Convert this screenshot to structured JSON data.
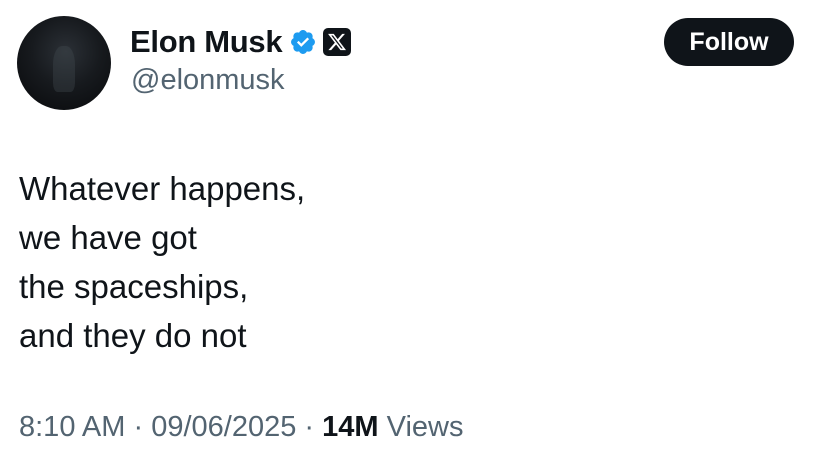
{
  "author": {
    "display_name": "Elon Musk",
    "handle": "@elonmusk",
    "avatar_icon": "avatar",
    "verified_icon": "verified-badge-icon",
    "verified_color": "#1d9bf0",
    "affiliation_icon": "x-logo-icon"
  },
  "follow_button": {
    "label": "Follow",
    "background": "#0f1419",
    "text_color": "#ffffff"
  },
  "tweet": {
    "lines": [
      "Whatever happens,",
      "we have got",
      "the spaceships,",
      "and they do not"
    ]
  },
  "meta": {
    "time": "8:10 AM",
    "separator": "·",
    "date": "09/06/2025",
    "views_count": "14M",
    "views_label": "Views"
  }
}
